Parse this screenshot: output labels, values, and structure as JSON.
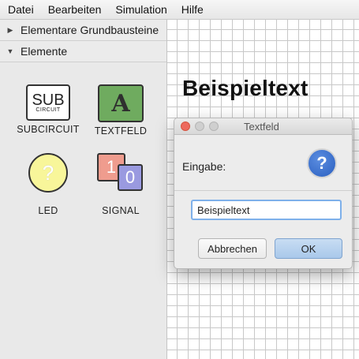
{
  "menu": [
    "Datei",
    "Bearbeiten",
    "Simulation",
    "Hilfe"
  ],
  "sections": [
    {
      "label": "Elementare Grundbausteine",
      "expanded": false,
      "arrow": "▶"
    },
    {
      "label": "Elemente",
      "expanded": true,
      "arrow": "▼"
    }
  ],
  "palette": {
    "subcircuit": {
      "label": "SUBCIRCUIT",
      "big": "SUB",
      "small": "CIRCUIT"
    },
    "textfeld": {
      "label": "TEXTFELD",
      "glyph": "A"
    },
    "led": {
      "label": "LED",
      "glyph": "?"
    },
    "signal": {
      "label": "SIGNAL",
      "one": "1",
      "zero": "0"
    }
  },
  "canvas": {
    "text": "Beispieltext"
  },
  "dialog": {
    "title": "Textfeld",
    "prompt": "Eingabe:",
    "icon": "question-icon",
    "icon_glyph": "?",
    "value": "Beispieltext",
    "cancel": "Abbrechen",
    "ok": "OK"
  },
  "colors": {
    "textfeld_green": "#6fab5f",
    "led_yellow": "#f8f69a",
    "signal_red": "#ef9c8e",
    "signal_blue": "#9a9ae0",
    "question_blue": "#2a5fc0",
    "ok_button": "#a9c8ea"
  }
}
